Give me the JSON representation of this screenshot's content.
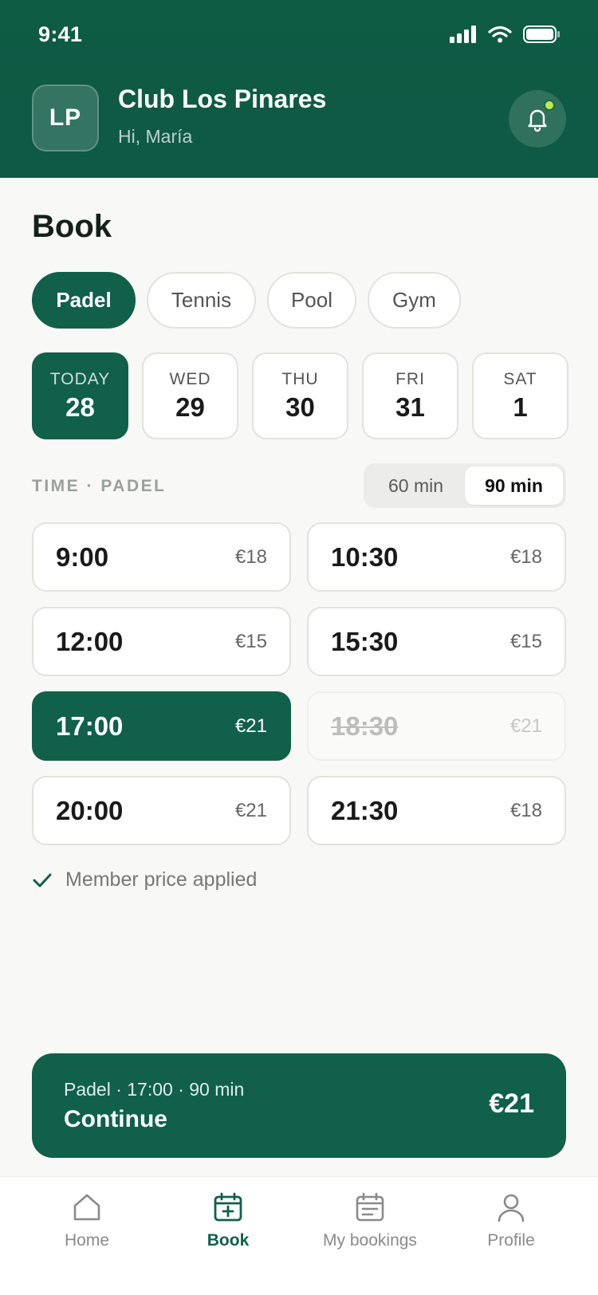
{
  "status_bar": {
    "time": "9:41"
  },
  "header": {
    "avatar_initials": "LP",
    "club_name": "Club Los Pinares",
    "greeting": "Hi, María"
  },
  "page": {
    "title": "Book"
  },
  "sports": [
    {
      "label": "Padel",
      "active": true
    },
    {
      "label": "Tennis",
      "active": false
    },
    {
      "label": "Pool",
      "active": false
    },
    {
      "label": "Gym",
      "active": false
    }
  ],
  "dates": [
    {
      "dow": "TODAY",
      "num": "28",
      "active": true
    },
    {
      "dow": "WED",
      "num": "29",
      "active": false
    },
    {
      "dow": "THU",
      "num": "30",
      "active": false
    },
    {
      "dow": "FRI",
      "num": "31",
      "active": false
    },
    {
      "dow": "SAT",
      "num": "1",
      "active": false
    }
  ],
  "time_section": {
    "label": "TIME · PADEL",
    "durations": [
      {
        "label": "60 min",
        "active": false
      },
      {
        "label": "90 min",
        "active": true
      }
    ]
  },
  "slots": [
    {
      "time": "9:00",
      "price": "€18",
      "state": "available"
    },
    {
      "time": "10:30",
      "price": "€18",
      "state": "available"
    },
    {
      "time": "12:00",
      "price": "€15",
      "state": "available"
    },
    {
      "time": "15:30",
      "price": "€15",
      "state": "available"
    },
    {
      "time": "17:00",
      "price": "€21",
      "state": "selected"
    },
    {
      "time": "18:30",
      "price": "€21",
      "state": "unavailable"
    },
    {
      "time": "20:00",
      "price": "€21",
      "state": "available"
    },
    {
      "time": "21:30",
      "price": "€18",
      "state": "available"
    }
  ],
  "member_note": "Member price applied",
  "cta": {
    "summary": "Padel · 17:00 · 90 min",
    "action": "Continue",
    "price": "€21"
  },
  "tabs": [
    {
      "label": "Home",
      "icon": "home-icon",
      "active": false
    },
    {
      "label": "Book",
      "icon": "calendar-plus-icon",
      "active": true
    },
    {
      "label": "My bookings",
      "icon": "calendar-list-icon",
      "active": false
    },
    {
      "label": "Profile",
      "icon": "user-icon",
      "active": false
    }
  ],
  "colors": {
    "brand": "#10604a",
    "notification_dot": "#c5e84a",
    "background": "#f8f8f6"
  }
}
